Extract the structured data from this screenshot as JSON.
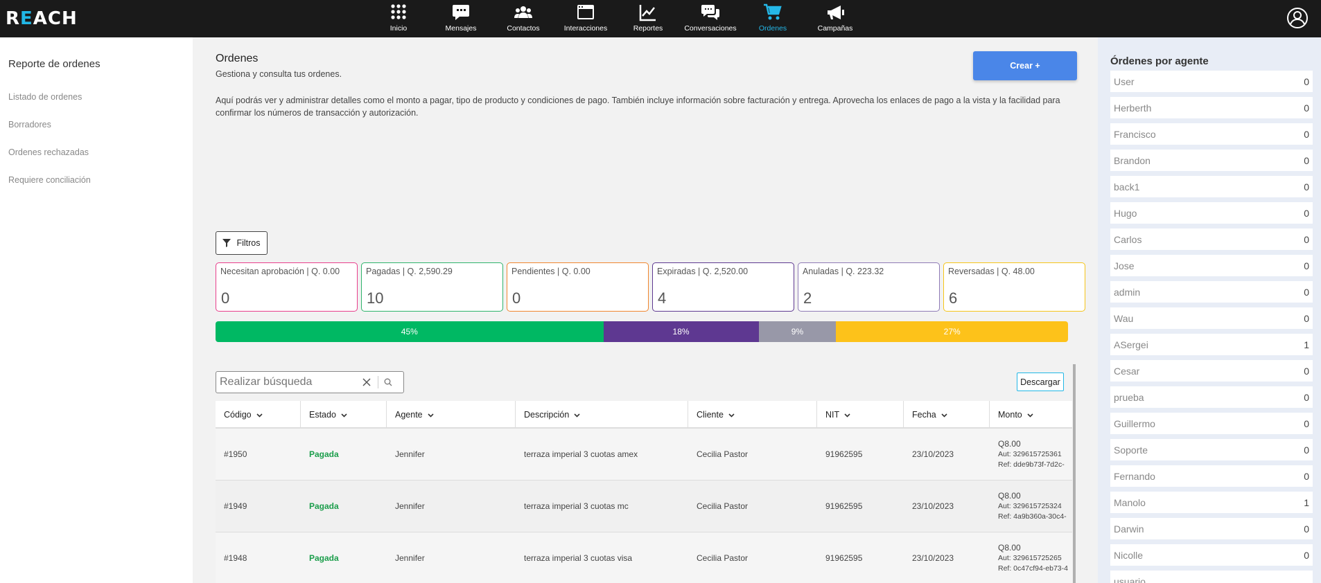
{
  "app": {
    "logo_pre": "R",
    "logo_e": "E",
    "logo_post": "ACH"
  },
  "nav": [
    {
      "label": "Inicio",
      "icon": "grid-icon"
    },
    {
      "label": "Mensajes",
      "icon": "message-icon"
    },
    {
      "label": "Contactos",
      "icon": "users-icon"
    },
    {
      "label": "Interacciones",
      "icon": "window-icon"
    },
    {
      "label": "Reportes",
      "icon": "chart-icon"
    },
    {
      "label": "Conversaciones",
      "icon": "chat-icon"
    },
    {
      "label": "Ordenes",
      "icon": "cart-icon",
      "active": true
    },
    {
      "label": "Campañas",
      "icon": "megaphone-icon"
    }
  ],
  "sidebar": {
    "title": "Reporte de ordenes",
    "links": [
      "Listado de ordenes",
      "Borradores",
      "Ordenes rechazadas",
      "Requiere conciliación"
    ]
  },
  "page": {
    "title": "Ordenes",
    "subtitle": "Gestiona y consulta tus ordenes.",
    "description": "Aquí podrás ver y administrar detalles como el monto a pagar, tipo de producto y condiciones de pago. También incluye información sobre facturación y entrega. Aprovecha los enlaces de pago a la vista y la facilidad para confirmar los números de transacción y autorización.",
    "create_label": "Crear +",
    "filters_label": "Filtros",
    "download_label": "Descargar"
  },
  "search": {
    "placeholder": "Realizar búsqueda",
    "value": ""
  },
  "status_cards": [
    {
      "label": "Necesitan aprobación | Q. 0.00",
      "count": "0",
      "color": "#e83e8c"
    },
    {
      "label": "Pagadas | Q. 2,590.29",
      "count": "10",
      "color": "#2fb36b"
    },
    {
      "label": "Pendientes | Q. 0.00",
      "count": "0",
      "color": "#f0862e"
    },
    {
      "label": "Expiradas | Q. 2,520.00",
      "count": "4",
      "color": "#5e3891"
    },
    {
      "label": "Anuladas | Q. 223.32",
      "count": "2",
      "color": "#8e7ab5"
    },
    {
      "label": "Reversadas | Q. 48.00",
      "count": "6",
      "color": "#f5c518"
    }
  ],
  "progress": [
    {
      "label": "45%",
      "value": 45.5,
      "color": "#00b863"
    },
    {
      "label": "18%",
      "value": 18.2,
      "color": "#5e3891"
    },
    {
      "label": "9%",
      "value": 9.1,
      "color": "#9898a8"
    },
    {
      "label": "27%",
      "value": 27.2,
      "color": "#fdc21a"
    }
  ],
  "table": {
    "columns": [
      "Código",
      "Estado",
      "Agente",
      "Descripción",
      "Cliente",
      "NIT",
      "Fecha",
      "Monto"
    ],
    "rows": [
      {
        "codigo": "#1950",
        "estado": "Pagada",
        "agente": "Jennifer",
        "descripcion": "terraza imperial 3 cuotas amex",
        "cliente": "Cecilia Pastor",
        "nit": "91962595",
        "fecha": "23/10/2023",
        "monto": "Q8.00",
        "aut": "Aut: 329615725361",
        "ref": "Ref: dde9b73f-7d2c-"
      },
      {
        "codigo": "#1949",
        "estado": "Pagada",
        "agente": "Jennifer",
        "descripcion": "terraza imperial 3 cuotas mc",
        "cliente": "Cecilia Pastor",
        "nit": "91962595",
        "fecha": "23/10/2023",
        "monto": "Q8.00",
        "aut": "Aut: 329615725324",
        "ref": "Ref: 4a9b360a-30c4-"
      },
      {
        "codigo": "#1948",
        "estado": "Pagada",
        "agente": "Jennifer",
        "descripcion": "terraza imperial 3 cuotas visa",
        "cliente": "Cecilia Pastor",
        "nit": "91962595",
        "fecha": "23/10/2023",
        "monto": "Q8.00",
        "aut": "Aut: 329615725265",
        "ref": "Ref: 0c47cf94-eb73-4"
      }
    ]
  },
  "agents_panel": {
    "title": "Órdenes por agente",
    "agents": [
      {
        "name": "User",
        "count": "0"
      },
      {
        "name": "Herberth",
        "count": "0"
      },
      {
        "name": "Francisco",
        "count": "0"
      },
      {
        "name": "Brandon",
        "count": "0"
      },
      {
        "name": "back1",
        "count": "0"
      },
      {
        "name": "Hugo",
        "count": "0"
      },
      {
        "name": "Carlos",
        "count": "0"
      },
      {
        "name": "Jose",
        "count": "0"
      },
      {
        "name": "admin",
        "count": "0"
      },
      {
        "name": "Wau",
        "count": "0"
      },
      {
        "name": "ASergei",
        "count": "1"
      },
      {
        "name": "Cesar",
        "count": "0"
      },
      {
        "name": "prueba",
        "count": "0"
      },
      {
        "name": "Guillermo",
        "count": "0"
      },
      {
        "name": "Soporte",
        "count": "0"
      },
      {
        "name": "Fernando",
        "count": "0"
      },
      {
        "name": "Manolo",
        "count": "1"
      },
      {
        "name": "Darwin",
        "count": "0"
      },
      {
        "name": "Nicolle",
        "count": "0"
      },
      {
        "name": "usuario",
        "count": ""
      }
    ]
  }
}
